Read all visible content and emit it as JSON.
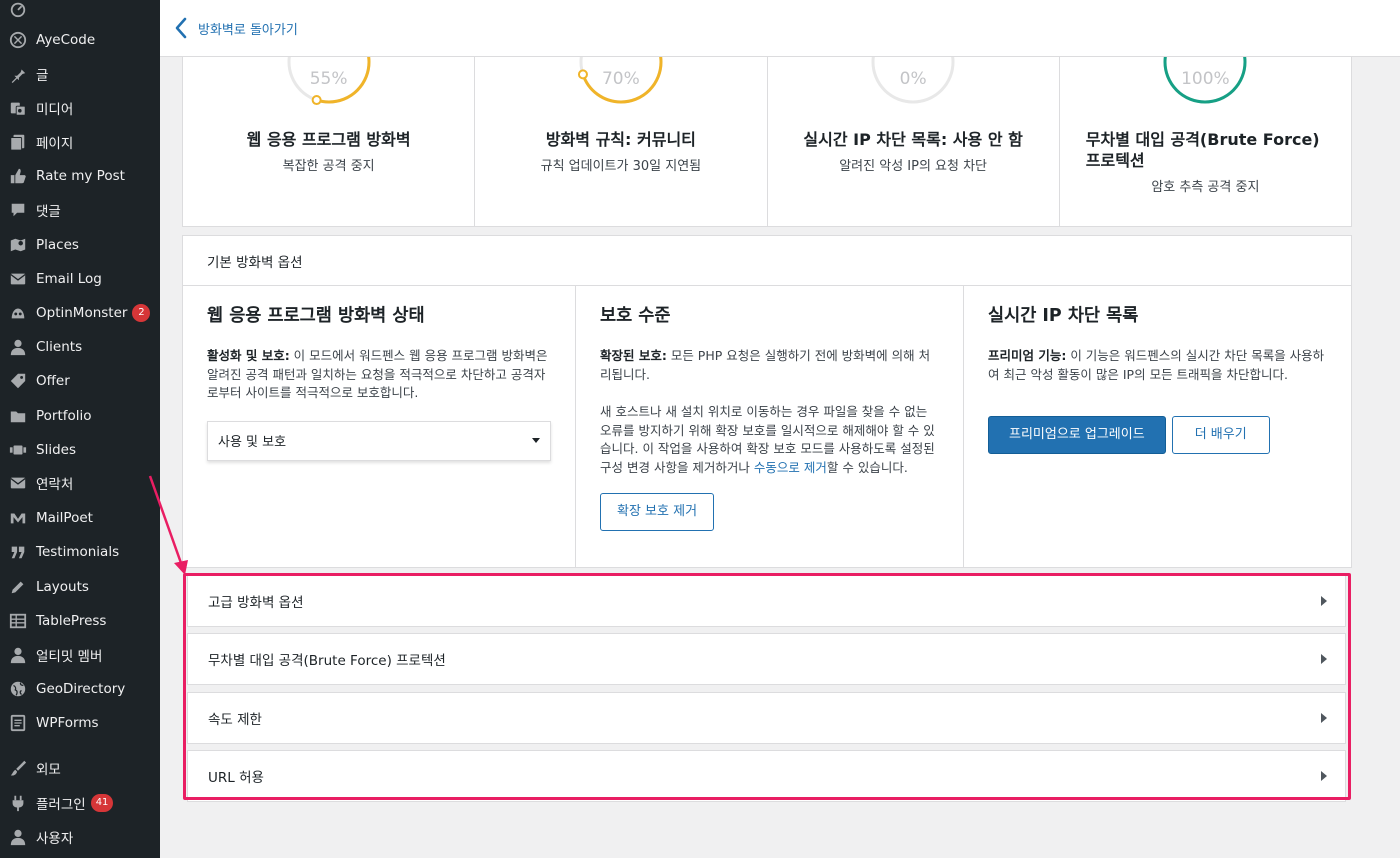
{
  "sidebar": {
    "items": [
      {
        "label": "",
        "icon": "dashboard-icon",
        "badge": ""
      },
      {
        "label": "AyeCode",
        "icon": "ayecode-icon",
        "badge": ""
      },
      {
        "label": "글",
        "icon": "pin-icon",
        "badge": ""
      },
      {
        "label": "미디어",
        "icon": "media-icon",
        "badge": ""
      },
      {
        "label": "페이지",
        "icon": "page-icon",
        "badge": ""
      },
      {
        "label": "Rate my Post",
        "icon": "thumbs-up-icon",
        "badge": ""
      },
      {
        "label": "댓글",
        "icon": "comment-icon",
        "badge": ""
      },
      {
        "label": "Places",
        "icon": "map-icon",
        "badge": ""
      },
      {
        "label": "Email Log",
        "icon": "email-icon",
        "badge": ""
      },
      {
        "label": "OptinMonster",
        "icon": "optinmonster-icon",
        "badge": "2"
      },
      {
        "label": "Clients",
        "icon": "user-icon",
        "badge": ""
      },
      {
        "label": "Offer",
        "icon": "tag-icon",
        "badge": ""
      },
      {
        "label": "Portfolio",
        "icon": "folder-icon",
        "badge": ""
      },
      {
        "label": "Slides",
        "icon": "slides-icon",
        "badge": ""
      },
      {
        "label": "연락처",
        "icon": "email-icon",
        "badge": ""
      },
      {
        "label": "MailPoet",
        "icon": "mailpoet-icon",
        "badge": ""
      },
      {
        "label": "Testimonials",
        "icon": "quote-icon",
        "badge": ""
      },
      {
        "label": "Layouts",
        "icon": "pencil-icon",
        "badge": ""
      },
      {
        "label": "TablePress",
        "icon": "table-icon",
        "badge": ""
      },
      {
        "label": "얼티밋 멤버",
        "icon": "user-icon",
        "badge": ""
      },
      {
        "label": "GeoDirectory",
        "icon": "globe-icon",
        "badge": ""
      },
      {
        "label": "WPForms",
        "icon": "form-icon",
        "badge": ""
      },
      {
        "label": "외모",
        "icon": "brush-icon",
        "badge": ""
      },
      {
        "label": "플러그인",
        "icon": "plugin-icon",
        "badge": "41"
      },
      {
        "label": "사용자",
        "icon": "user-icon",
        "badge": ""
      }
    ]
  },
  "topbar": {
    "back_label": "방화벽로 돌아가기"
  },
  "stats": [
    {
      "percent": "55%",
      "value": 0.55,
      "title": "웹 응용 프로그램 방화벽",
      "subtitle": "복잡한 공격 중지",
      "color": "#f0b429"
    },
    {
      "percent": "70%",
      "value": 0.7,
      "title": "방화벽 규칙: 커뮤니티",
      "subtitle": "규칙 업데이트가 30일 지연됨",
      "color": "#f0b429"
    },
    {
      "percent": "0%",
      "value": 0,
      "title": "실시간 IP 차단 목록: 사용 안 함",
      "subtitle": "알려진 악성 IP의 요청 차단",
      "color": "#dcdcde"
    },
    {
      "percent": "100%",
      "value": 1.0,
      "title": "무차별 대입 공격(Brute Force) 프로텍션",
      "subtitle": "암호 추측 공격 중지",
      "color": "#16a085"
    }
  ],
  "basic_panel": {
    "heading": "기본 방화벽 옵션",
    "waf_status": {
      "title": "웹 응용 프로그램 방화벽 상태",
      "desc_bold": "활성화 및 보호:",
      "desc": " 이 모드에서 워드펜스 웹 응용 프로그램 방화벽은 알려진 공격 패턴과 일치하는 요청을 적극적으로 차단하고 공격자로부터 사이트를 적극적으로 보호합니다.",
      "select_value": "사용 및 보호"
    },
    "protection_level": {
      "title": "보호 수준",
      "desc_bold": "확장된 보호:",
      "desc": " 모든 PHP 요청은 실행하기 전에 방화벽에 의해 처리됩니다.",
      "desc2_a": "새 호스트나 새 설치 위치로 이동하는 경우 파일을 찾을 수 없는 오류를 방지하기 위해 확장 보호를 일시적으로 해제해야 할 수 있습니다. 이 작업을 사용하여 확장 보호 모드를 사용하도록 설정된 구성 변경 사항을 제거하거나 ",
      "desc2_link": "수동으로 제거",
      "desc2_b": "할 수 있습니다.",
      "button": "확장 보호 제거"
    },
    "realtime_ip": {
      "title": "실시간 IP 차단 목록",
      "desc_bold": "프리미엄 기능:",
      "desc": " 이 기능은 워드펜스의 실시간 차단 목록을 사용하여 최근 악성 활동이 많은 IP의 모든 트래픽을 차단합니다.",
      "upgrade_button": "프리미엄으로 업그레이드",
      "learn_button": "더 배우기"
    }
  },
  "accordions": [
    {
      "label": "고급 방화벽 옵션"
    },
    {
      "label": "무차별 대입 공격(Brute Force) 프로텍션"
    },
    {
      "label": "속도 제한"
    },
    {
      "label": "URL 허용"
    }
  ],
  "colors": {
    "accent": "#2271b1",
    "sidebar_bg": "#1d2327",
    "highlight": "#e91e63",
    "badge": "#d63638"
  }
}
